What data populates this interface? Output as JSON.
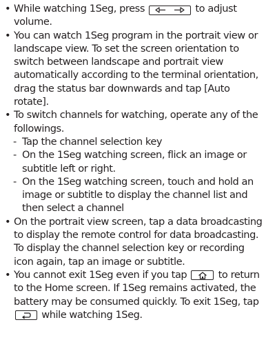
{
  "bullets": {
    "b1": {
      "before_key": "While watching 1Seg, press",
      "after_key": "to adjust volume."
    },
    "b2": {
      "text": "You can watch 1Seg program in the portrait view or landscape view. To set the screen orientation to switch between landscape and portrait view automatically according to the terminal orientation, drag the status bar downwards and tap [Auto rotate]."
    },
    "b3": {
      "text": "To switch channels for watching, operate any of the followings.",
      "sub_items": [
        "Tap the channel selection key",
        "On the 1Seg watching screen, flick an image or subtitle left or right.",
        "On the 1Seg watching screen, touch and hold an image or subtitle to display the channel list and then select a channel"
      ]
    },
    "b4": {
      "text": "On the portrait view screen, tap a data broadcasting to display the remote control for data broadcasting. To display the channel selection key or recording icon again, tap an image or subtitle."
    },
    "b5": {
      "before_home_key": "You cannot exit 1Seg even if you tap",
      "after_home_key": "to return to the Home screen. If 1Seg remains activated, the battery may be consumed quickly. To exit 1Seg, tap",
      "after_back_key": "while watching 1Seg."
    }
  },
  "icons": {
    "volume_key": "volume-left-right-key-icon",
    "home_key": "home-key-icon",
    "back_key": "back-key-icon"
  }
}
